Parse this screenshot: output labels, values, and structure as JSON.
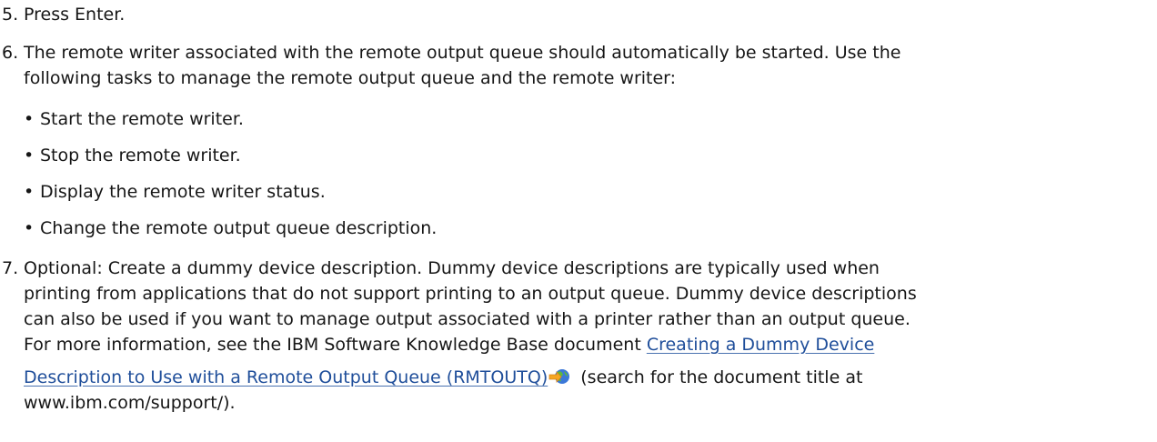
{
  "steps": {
    "s5": {
      "number": "5.",
      "text": "Press Enter."
    },
    "s6": {
      "number": "6.",
      "line1": "The remote writer associated with the remote output queue should automatically be started. Use the",
      "line2": "following tasks to manage the remote output queue and the remote writer:",
      "bullets": [
        "Start the remote writer.",
        "Stop the remote writer.",
        "Display the remote writer status.",
        "Change the remote output queue description."
      ]
    },
    "s7": {
      "number": "7.",
      "line1": "Optional: Create a dummy device description. Dummy device descriptions are typically used when",
      "line2": "printing from applications that do not support printing to an output queue. Dummy device descriptions",
      "line3": "can also be used if you want to manage output associated with a printer rather than an output queue.",
      "line4_prefix": "For more information, see the IBM Software Knowledge Base document ",
      "link_part1": "Creating a Dummy Device",
      "link_part2": "Description to Use with a Remote Output Queue (RMTOUTQ)",
      "line5_suffix": " (search for the document title at",
      "line6": "www.ibm.com/support/).",
      "icon": "external-link-icon"
    }
  },
  "colors": {
    "text": "#161616",
    "link_underline": "#4a72b0"
  }
}
